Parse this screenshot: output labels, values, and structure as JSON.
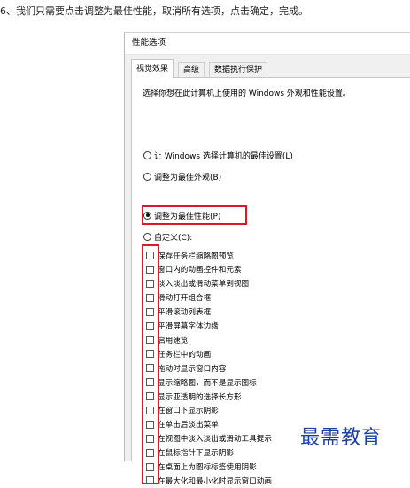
{
  "instruction": "6、我们只需要点击调整为最佳性能，取消所有选项，点击确定，完成。",
  "dialog": {
    "title": "性能选项",
    "tabs": [
      {
        "label": "视觉效果"
      },
      {
        "label": "高级"
      },
      {
        "label": "数据执行保护"
      }
    ],
    "description": "选择你想在此计算机上使用的 Windows 外观和性能设置。",
    "radios": [
      {
        "label": "让 Windows 选择计算机的最佳设置(L)",
        "selected": false
      },
      {
        "label": "调整为最佳外观(B)",
        "selected": false
      },
      {
        "label": "调整为最佳性能(P)",
        "selected": true
      },
      {
        "label": "自定义(C):",
        "selected": false
      }
    ],
    "checkboxes": [
      {
        "label": "保存任务栏缩略图预览",
        "checked": false
      },
      {
        "label": "窗口内的动画控件和元素",
        "checked": false
      },
      {
        "label": "淡入淡出或滑动菜单到视图",
        "checked": false
      },
      {
        "label": "滑动打开组合框",
        "checked": false
      },
      {
        "label": "平滑滚动列表框",
        "checked": false
      },
      {
        "label": "平滑屏幕字体边缘",
        "checked": false
      },
      {
        "label": "启用速览",
        "checked": false
      },
      {
        "label": "任务栏中的动画",
        "checked": false
      },
      {
        "label": "拖动时显示窗口内容",
        "checked": false
      },
      {
        "label": "显示缩略图，而不是显示图标",
        "checked": false
      },
      {
        "label": "显示亚透明的选择长方形",
        "checked": false
      },
      {
        "label": "在窗口下显示阴影",
        "checked": false
      },
      {
        "label": "在单击后淡出菜单",
        "checked": false
      },
      {
        "label": "在视图中淡入淡出或滑动工具提示",
        "checked": false
      },
      {
        "label": "在鼠标指针下显示阴影",
        "checked": false
      },
      {
        "label": "在桌面上为图标标签使用阴影",
        "checked": false
      },
      {
        "label": "在最大化和最小化时显示窗口动画",
        "checked": false
      }
    ]
  },
  "watermark": "最需教育",
  "colors": {
    "highlight": "#d7192b",
    "watermark": "#1b3fa6",
    "dialog_bg": "#f0f0f0"
  }
}
